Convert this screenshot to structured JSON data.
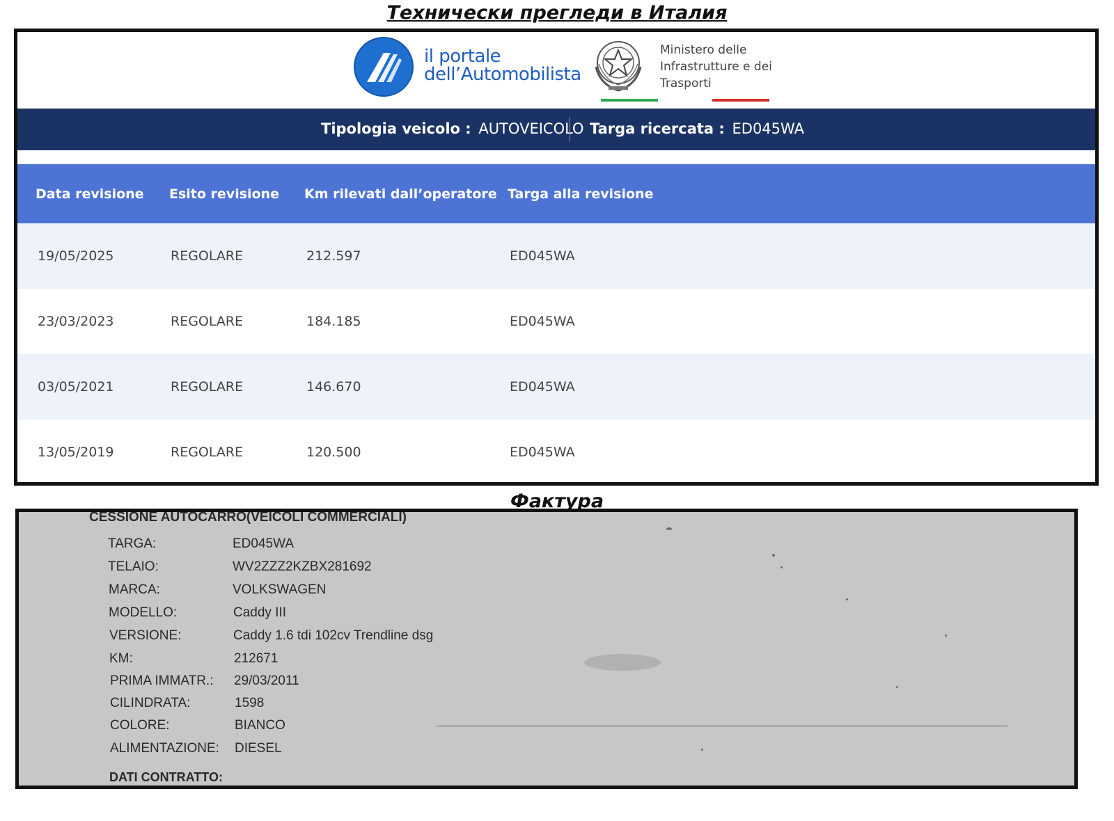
{
  "titles": {
    "top": "Технически прегледи в Италия",
    "bottom": "Фактура"
  },
  "header": {
    "portale_line1": "il portale",
    "portale_line2": "dell’Automobilista",
    "ministero_line1": "Ministero delle",
    "ministero_line2": "Infrastrutture e dei",
    "ministero_line3": "Trasporti"
  },
  "vehicle_bar": {
    "type_label": "Tipologia veicolo :",
    "type_value": "AUTOVEICOLO",
    "plate_label": "Targa ricercata :",
    "plate_value": "ED045WA"
  },
  "table": {
    "columns": [
      "Data revisione",
      "Esito revisione",
      "Km rilevati dall’operatore",
      "Targa alla revisione"
    ],
    "rows": [
      [
        "19/05/2025",
        "REGOLARE",
        "212.597",
        "ED045WA"
      ],
      [
        "23/03/2023",
        "REGOLARE",
        "184.185",
        "ED045WA"
      ],
      [
        "03/05/2021",
        "REGOLARE",
        "146.670",
        "ED045WA"
      ],
      [
        "13/05/2019",
        "REGOLARE",
        "120.500",
        "ED045WA"
      ]
    ]
  },
  "invoice": {
    "heading": "CESSIONE AUTOCARRO(VEICOLI COMMERCIALI)",
    "fields": [
      {
        "label": "TARGA:",
        "value": "ED045WA"
      },
      {
        "label": "TELAIO:",
        "value": "WV2ZZZ2KZBX281692"
      },
      {
        "label": "MARCA:",
        "value": "VOLKSWAGEN"
      },
      {
        "label": "MODELLO:",
        "value": "Caddy III"
      },
      {
        "label": "VERSIONE:",
        "value": "Caddy 1.6 tdi 102cv Trendline dsg"
      },
      {
        "label": "KM:",
        "value": "212671"
      },
      {
        "label": "PRIMA IMMATR.:",
        "value": "29/03/2011"
      },
      {
        "label": "CILINDRATA:",
        "value": "1598"
      },
      {
        "label": "COLORE:",
        "value": "BIANCO"
      },
      {
        "label": "ALIMENTAZIONE:",
        "value": "DIESEL"
      }
    ],
    "contract_heading": "DATI CONTRATTO:"
  },
  "colors": {
    "navy_bar": "#1b3364",
    "table_header": "#4d74d4",
    "row_alt": "#eef2fb",
    "portale_blue": "#1f5fbf",
    "flag_green": "#33a852",
    "flag_red": "#d62b2b"
  }
}
